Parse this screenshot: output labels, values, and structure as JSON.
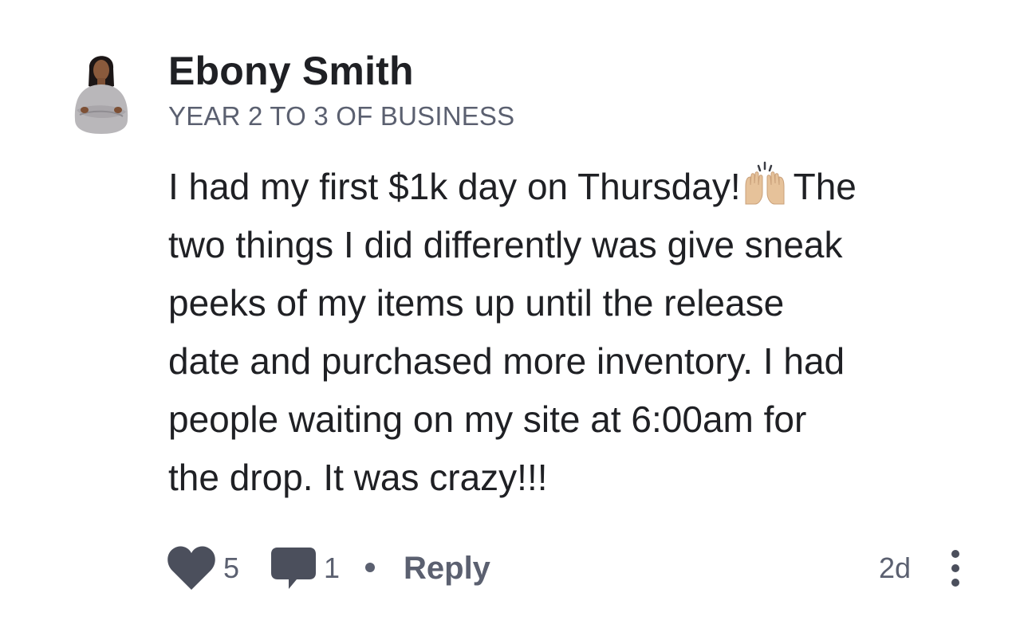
{
  "comment": {
    "author": {
      "name": "Ebony Smith",
      "subtitle": "YEAR 2 TO 3 OF BUSINESS"
    },
    "body_lines": [
      "I had my first $1k day on Thursday!",
      "two things I did differently was give sneak",
      "peeks of my items up until the release",
      "date and purchased more inventory. I had",
      "people waiting on my site at 6:00am for",
      "the drop. It was crazy!!!"
    ],
    "body_line1_after_emoji": "The",
    "emoji_icon": "raising-hands-icon",
    "actions": {
      "like_icon": "heart-icon",
      "like_count": "5",
      "comment_icon": "comment-icon",
      "comment_count": "1",
      "reply_label": "Reply",
      "time_ago": "2d",
      "more_icon": "more-vertical-icon"
    },
    "colors": {
      "text": "#1f2024",
      "muted": "#5b6070",
      "icon": "#4b4f5c",
      "emoji_skin": "#e6c29a"
    }
  }
}
